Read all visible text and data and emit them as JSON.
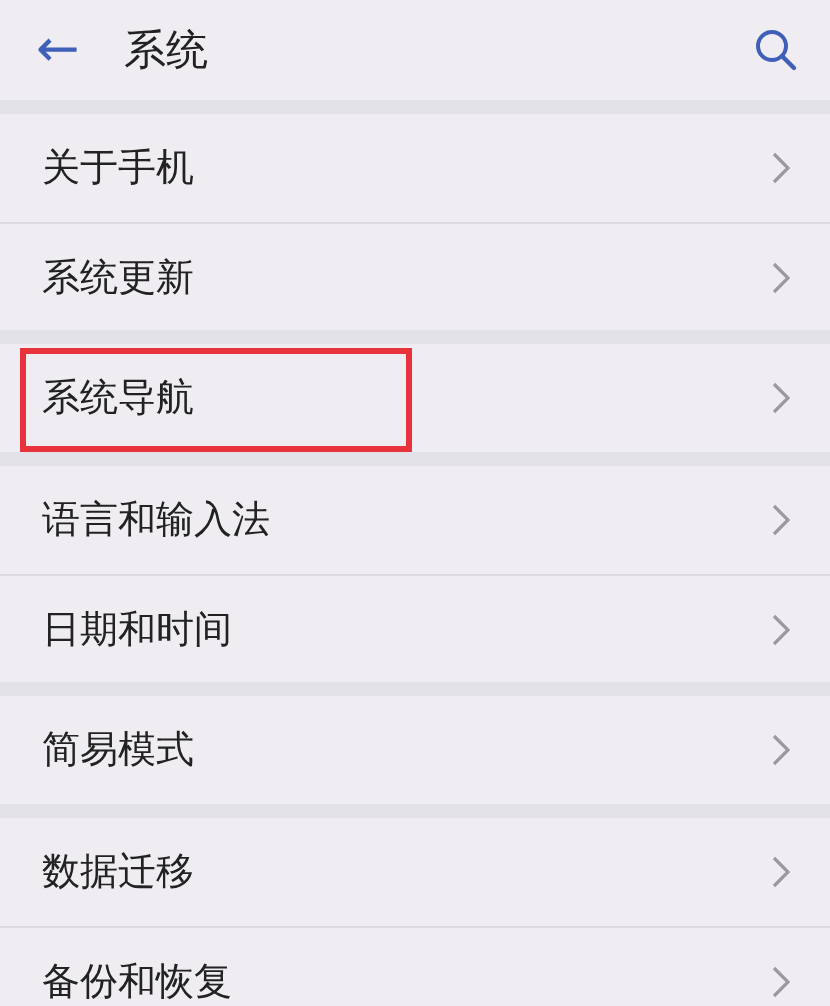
{
  "header": {
    "back": "←",
    "title": "系统"
  },
  "sections": [
    {
      "items": [
        {
          "label": "关于手机",
          "highlighted": false
        },
        {
          "label": "系统更新",
          "highlighted": false
        }
      ]
    },
    {
      "items": [
        {
          "label": "系统导航",
          "highlighted": true
        }
      ]
    },
    {
      "items": [
        {
          "label": "语言和输入法",
          "highlighted": false
        },
        {
          "label": "日期和时间",
          "highlighted": false
        }
      ]
    },
    {
      "items": [
        {
          "label": "简易模式",
          "highlighted": false
        }
      ]
    },
    {
      "items": [
        {
          "label": "数据迁移",
          "highlighted": false
        },
        {
          "label": "备份和恢复",
          "highlighted": false
        }
      ]
    }
  ]
}
